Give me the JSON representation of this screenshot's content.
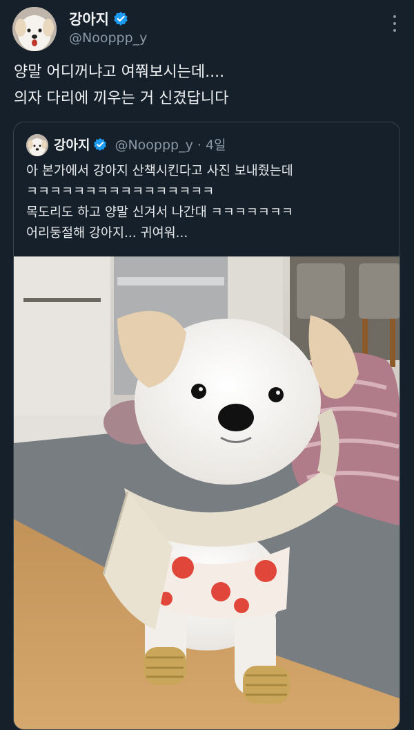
{
  "tweet": {
    "display_name": "강아지",
    "handle": "@Nooppp_y",
    "text_lines": [
      "양말 어디꺼냐고 여쭤보시는데....",
      "의자 다리에 끼우는 거 신겼답니다"
    ]
  },
  "quote": {
    "display_name": "강아지",
    "handle_time": "@Nooppp_y · 4일",
    "text_lines": [
      "아 본가에서 강아지 산책시킨다고 사진 보내줬는데",
      "ㅋㅋㅋㅋㅋㅋㅋㅋㅋㅋㅋㅋㅋㅋㅋㅋ",
      "목도리도 하고 양말 신겨서 나간대 ㅋㅋㅋㅋㅋㅋㅋ",
      "어리둥절해 강아지... 귀여워..."
    ]
  },
  "icons": {
    "verified": "verified-badge-icon",
    "more": "more-options-icon"
  },
  "colors": {
    "background": "#15202b",
    "verified_blue": "#1d9bf0",
    "secondary_text": "#8b98a5",
    "border": "#38444d"
  }
}
